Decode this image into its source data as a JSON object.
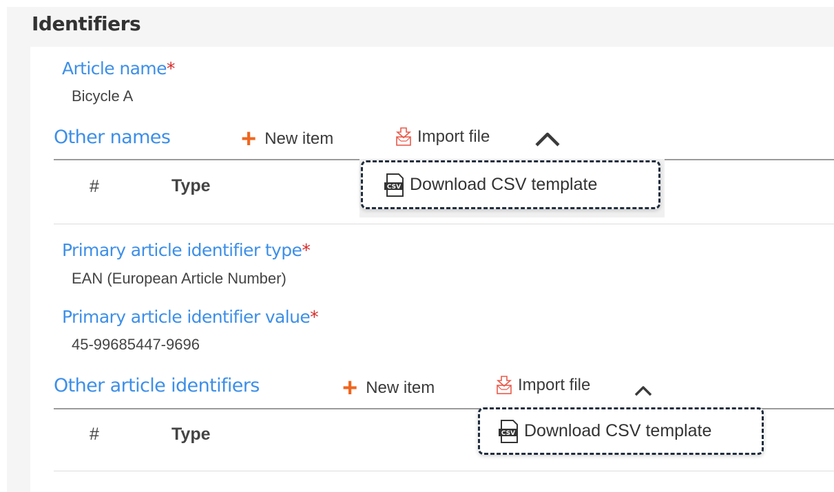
{
  "section": {
    "title": "Identifiers"
  },
  "article_name": {
    "label": "Article name",
    "required_mark": "*",
    "value": "Bicycle A"
  },
  "other_names": {
    "title": "Other names",
    "new_item": "New item",
    "import_file": "Import file",
    "dropdown_item": "Download CSV template",
    "columns": [
      "#",
      "Type"
    ]
  },
  "primary_type": {
    "label": "Primary article identifier type",
    "required_mark": "*",
    "value": "EAN (European Article Number)"
  },
  "primary_value": {
    "label": "Primary article identifier value",
    "required_mark": "*",
    "value": "45-99685447-9696"
  },
  "other_identifiers": {
    "title": "Other article identifiers",
    "new_item": "New item",
    "import_file": "Import file",
    "dropdown_item": "Download CSV template",
    "columns": [
      "#",
      "Type"
    ]
  },
  "icons": {
    "plus": "plus-icon",
    "import": "import-file-icon",
    "chevron": "chevron-up-icon",
    "csv": "csv-file-icon"
  },
  "colors": {
    "label_blue": "#3d8fe8",
    "required_red": "#d52b2b",
    "accent_orange": "#f0661f",
    "dashed_border": "#1f2d3d"
  }
}
